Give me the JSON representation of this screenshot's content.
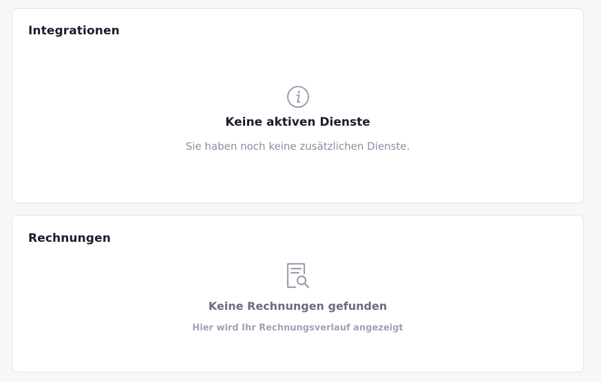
{
  "integrations": {
    "title": "Integrationen",
    "icon": "info-circle-icon",
    "empty_title": "Keine aktiven Dienste",
    "empty_text": "Sie haben noch keine zusätzlichen Dienste."
  },
  "invoices": {
    "title": "Rechnungen",
    "icon": "document-search-icon",
    "empty_title": "Keine Rechnungen gefunden",
    "empty_text": "Hier wird Ihr Rechnungsverlauf angezeigt"
  },
  "colors": {
    "background": "#f7f7f9",
    "card": "#ffffff",
    "heading": "#1c1c2e",
    "muted": "#8d8b9f",
    "icon": "#9e9cb0"
  }
}
